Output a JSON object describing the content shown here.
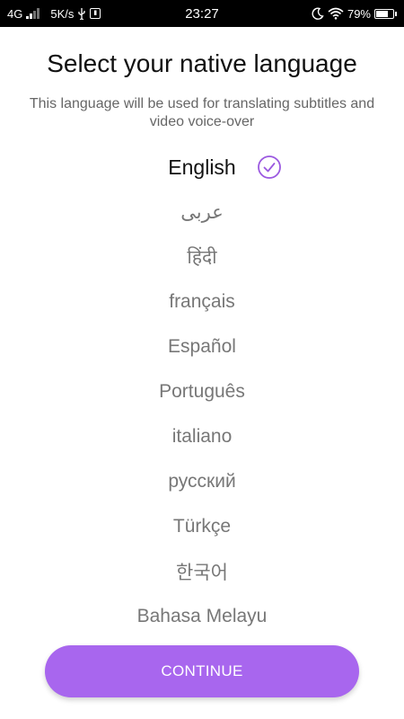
{
  "status_bar": {
    "network": "4G",
    "speed": "5K/s",
    "time": "23:27",
    "battery": "79%",
    "battery_level": 0.79,
    "icons": [
      "signal-icon",
      "usb-icon",
      "notification-icon",
      "moon-icon",
      "wifi-icon",
      "battery-icon"
    ]
  },
  "page": {
    "title": "Select your native language",
    "subtitle": "This language will be used for translating subtitles and video voice-over"
  },
  "languages": [
    {
      "label": "English",
      "selected": true
    },
    {
      "label": "عربى",
      "selected": false
    },
    {
      "label": "हिंदी",
      "selected": false
    },
    {
      "label": "français",
      "selected": false
    },
    {
      "label": "Español",
      "selected": false
    },
    {
      "label": "Português",
      "selected": false
    },
    {
      "label": "italiano",
      "selected": false
    },
    {
      "label": "русский",
      "selected": false
    },
    {
      "label": "Türkçe",
      "selected": false
    },
    {
      "label": "한국어",
      "selected": false
    },
    {
      "label": "Bahasa Melayu",
      "selected": false
    }
  ],
  "continue_label": "CONTINUE",
  "colors": {
    "accent": "#a866ee",
    "check": "#9b59e0"
  }
}
